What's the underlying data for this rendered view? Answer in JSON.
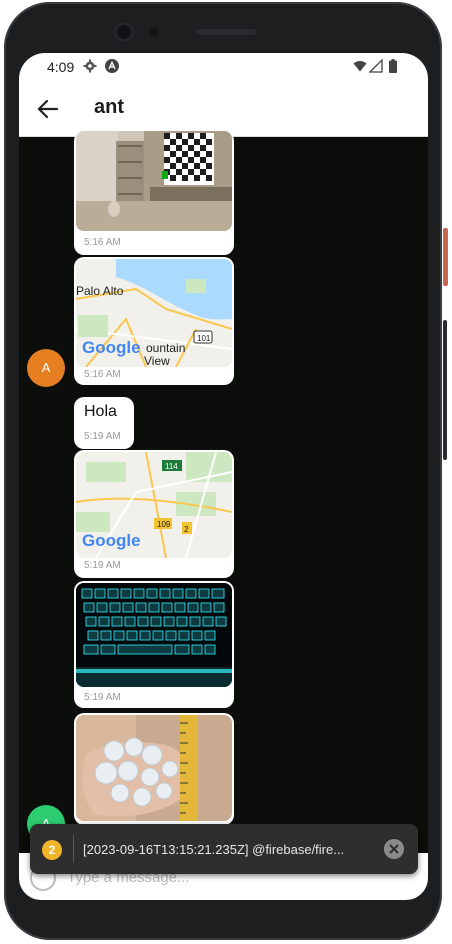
{
  "status": {
    "time": "4:09"
  },
  "header": {
    "title": "ant"
  },
  "messages": [
    {
      "kind": "image",
      "subject": "living room with tv",
      "time": "5:16 AM"
    },
    {
      "kind": "map",
      "labels": [
        "Palo Alto",
        "Google",
        "ountain",
        "View",
        "101"
      ],
      "time": "5:16 AM"
    },
    {
      "kind": "text",
      "text": "Hola",
      "time": "5:19 AM"
    },
    {
      "kind": "map",
      "labels": [
        "114",
        "Google",
        "109",
        "2"
      ],
      "time": "5:19 AM"
    },
    {
      "kind": "image",
      "subject": "backlit keyboard",
      "time": "5:19 AM"
    },
    {
      "kind": "image",
      "subject": "hailstones in hand",
      "time": ""
    }
  ],
  "avatars": [
    {
      "letter": "A",
      "color": "#e67e22"
    },
    {
      "letter": "A",
      "color": "#2ecc71"
    }
  ],
  "composer": {
    "placeholder": "Type a message..."
  },
  "toast": {
    "count": "2",
    "text": "[2023-09-16T13:15:21.235Z]  @firebase/fire..."
  },
  "colors": {
    "map_water": "#aadaff",
    "map_land": "#f2f0ea",
    "map_green": "#cde8c1",
    "map_road": "#f9c74f"
  },
  "icons": [
    "settings-icon",
    "app-icon",
    "wifi-icon",
    "signal-icon",
    "battery-icon",
    "back-arrow-icon",
    "close-icon"
  ]
}
